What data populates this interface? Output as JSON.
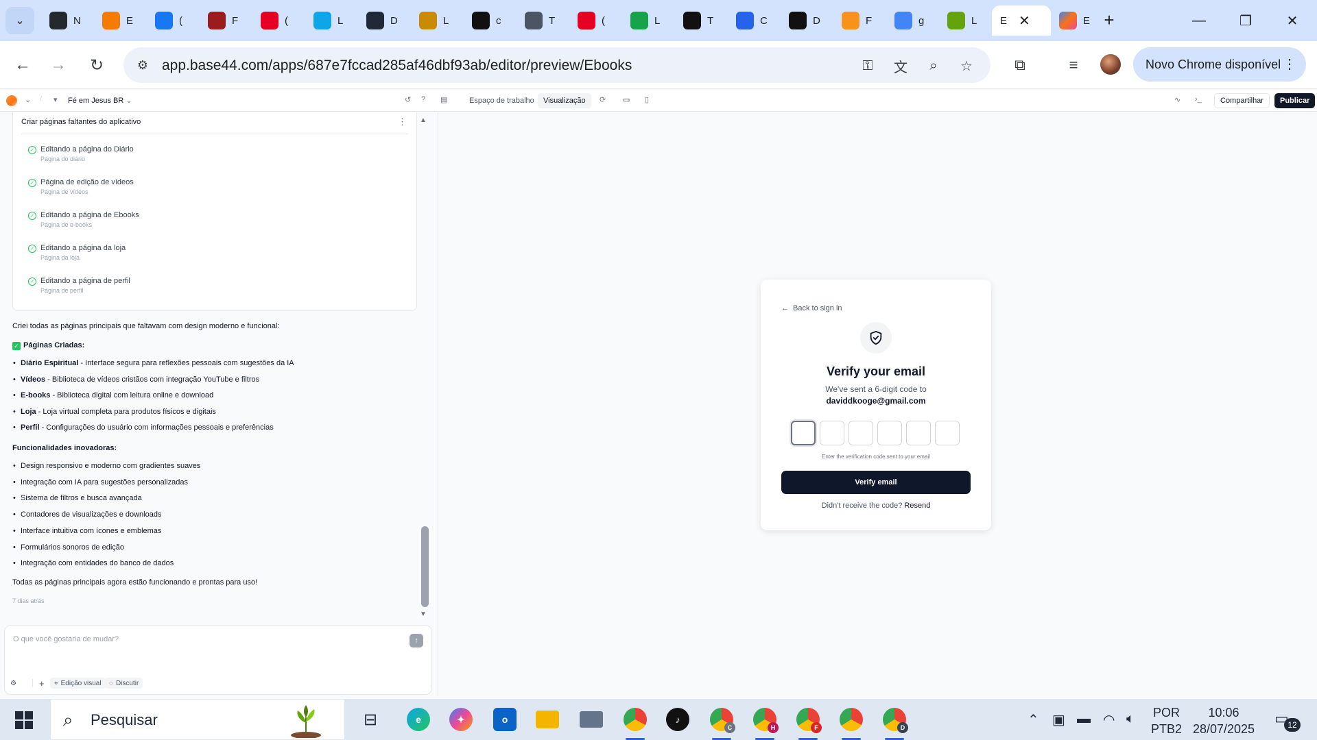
{
  "browser": {
    "tabs": [
      {
        "icon": "github-icon",
        "title": "N",
        "color": "#24292f"
      },
      {
        "icon": "blogger-icon",
        "title": "E",
        "color": "#f57c00"
      },
      {
        "icon": "facebook-icon",
        "title": "(",
        "color": "#1877f2"
      },
      {
        "icon": "book-icon",
        "title": "F",
        "color": "#9b1c1c"
      },
      {
        "icon": "pinterest-icon",
        "title": "(",
        "color": "#e60023"
      },
      {
        "icon": "search-app-icon",
        "title": "L",
        "color": "#0ea5e9"
      },
      {
        "icon": "dn-ai-icon",
        "title": "D",
        "color": "#1f2937"
      },
      {
        "icon": "food-icon",
        "title": "L",
        "color": "#ca8a04"
      },
      {
        "icon": "capcut-icon",
        "title": "c",
        "color": "#111111"
      },
      {
        "icon": "globe-icon",
        "title": "T",
        "color": "#4b5563"
      },
      {
        "icon": "pinterest-icon",
        "title": "(",
        "color": "#e60023"
      },
      {
        "icon": "app-green-icon",
        "title": "L",
        "color": "#16a34a"
      },
      {
        "icon": "tiktok-icon",
        "title": "T",
        "color": "#111111"
      },
      {
        "icon": "canva-icon",
        "title": "C",
        "color": "#2563eb"
      },
      {
        "icon": "openai-icon",
        "title": "D",
        "color": "#111111"
      },
      {
        "icon": "bitcoin-icon",
        "title": "F",
        "color": "#f7931a"
      },
      {
        "icon": "google-icon",
        "title": "g",
        "color": "#4285f4"
      },
      {
        "icon": "letter-l-icon",
        "title": "L",
        "color": "#65a30d"
      }
    ],
    "active_tab": {
      "title": "E",
      "close": "✕"
    },
    "last_tab": {
      "icon": "base44-icon",
      "title": "E",
      "color": "#f97316"
    },
    "new_tab": "+",
    "url": "app.base44.com/apps/687e7fccad285af46dbf93ab/editor/preview/Ebooks",
    "update_chip": "Novo Chrome disponível"
  },
  "app_header": {
    "project_name": "Fé em Jesus BR",
    "tab_workspace": "Espaço de trabalho",
    "tab_preview": "Visualização",
    "share": "Compartilhar",
    "publish": "Publicar"
  },
  "chat": {
    "task_card": {
      "title": "Criar páginas faltantes do aplicativo",
      "tasks": [
        {
          "title": "Editando a página do Diário",
          "subtitle": "Página do diário"
        },
        {
          "title": "Página de edição de vídeos",
          "subtitle": "Página de vídeos"
        },
        {
          "title": "Editando a página de Ebooks",
          "subtitle": "Página de e-books"
        },
        {
          "title": "Editando a página da loja",
          "subtitle": "Página da loja"
        },
        {
          "title": "Editando a página de perfil",
          "subtitle": "Página de perfil"
        }
      ]
    },
    "intro": "Criei todas as páginas principais que faltavam com design moderno e funcional:",
    "pages_heading": "Páginas Criadas:",
    "pages": [
      {
        "name": "Diário Espiritual",
        "desc": " - Interface segura para reflexões pessoais com sugestões da IA"
      },
      {
        "name": "Vídeos",
        "desc": " - Biblioteca de vídeos cristãos com integração YouTube e filtros"
      },
      {
        "name": "E-books",
        "desc": " - Biblioteca digital com leitura online e download"
      },
      {
        "name": "Loja",
        "desc": " - Loja virtual completa para produtos físicos e digitais"
      },
      {
        "name": "Perfil",
        "desc": " - Configurações do usuário com informações pessoais e preferências"
      }
    ],
    "features_heading": "Funcionalidades inovadoras:",
    "features": [
      "Design responsivo e moderno com gradientes suaves",
      "Integração com IA para sugestões personalizadas",
      "Sistema de filtros e busca avançada",
      "Contadores de visualizações e downloads",
      "Interface intuitiva com ícones e emblemas",
      "Formulários sonoros de edição",
      "Integração com entidades do banco de dados"
    ],
    "closing": "Todas as páginas principais agora estão funcionando e prontas para uso!",
    "timestamp": "7 dias atrás",
    "composer": {
      "placeholder": "O que você gostaria de mudar?",
      "visual_edit": "Edição visual",
      "discuss": "Discutir"
    }
  },
  "verify_card": {
    "back": "Back to sign in",
    "title": "Verify your email",
    "subtitle": "We've sent a 6-digit code to",
    "email": "daviddkooge@gmail.com",
    "help": "Enter the verification code sent to your email",
    "button": "Verify email",
    "resend_prompt": "Didn't receive the code? ",
    "resend_link": "Resend"
  },
  "taskbar": {
    "search_label": "Pesquisar",
    "lang_top": "POR",
    "lang_bottom": "PTB2",
    "time": "10:06",
    "date": "28/07/2025",
    "notification_count": "12",
    "chrome_badges": [
      "C",
      "H",
      "F",
      "",
      "D"
    ]
  },
  "colors": {
    "accent_dark": "#0f172a",
    "success": "#22c55e",
    "chrome_tab_strip": "#d3e3fd"
  }
}
